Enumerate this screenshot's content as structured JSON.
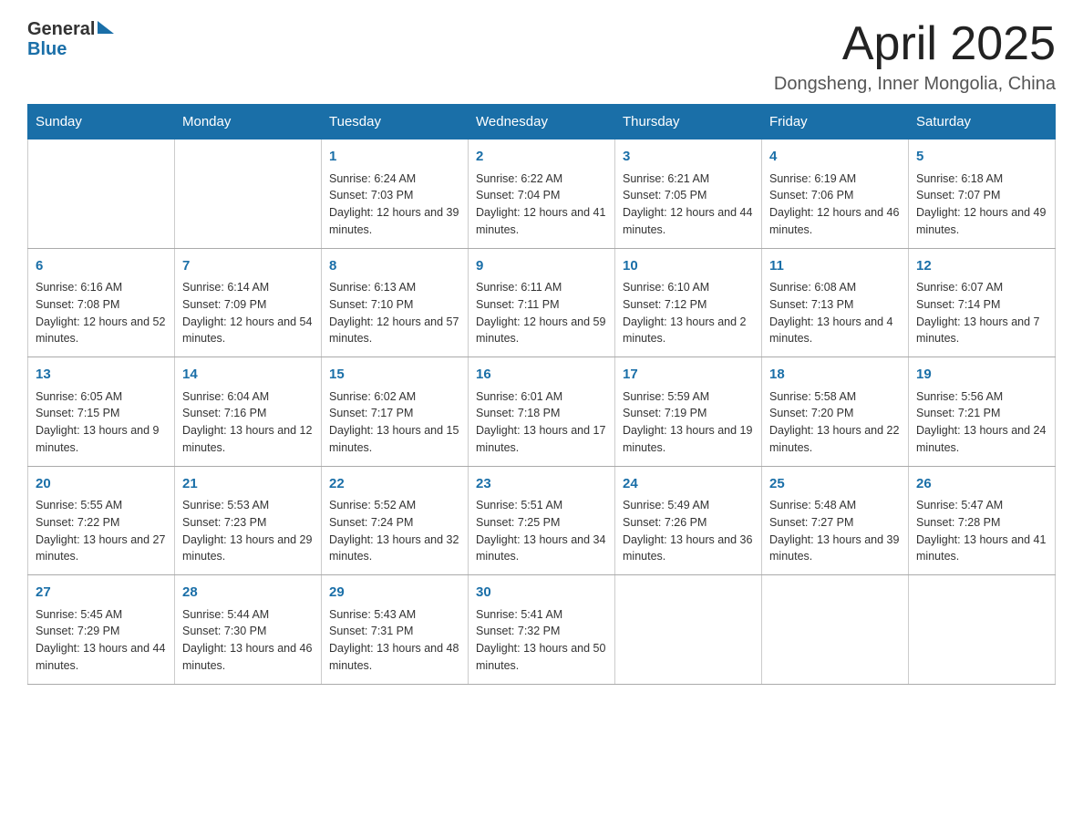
{
  "header": {
    "logo_general": "General",
    "logo_blue": "Blue",
    "month_year": "April 2025",
    "location": "Dongsheng, Inner Mongolia, China"
  },
  "weekdays": [
    "Sunday",
    "Monday",
    "Tuesday",
    "Wednesday",
    "Thursday",
    "Friday",
    "Saturday"
  ],
  "weeks": [
    [
      {
        "day": "",
        "sunrise": "",
        "sunset": "",
        "daylight": ""
      },
      {
        "day": "",
        "sunrise": "",
        "sunset": "",
        "daylight": ""
      },
      {
        "day": "1",
        "sunrise": "Sunrise: 6:24 AM",
        "sunset": "Sunset: 7:03 PM",
        "daylight": "Daylight: 12 hours and 39 minutes."
      },
      {
        "day": "2",
        "sunrise": "Sunrise: 6:22 AM",
        "sunset": "Sunset: 7:04 PM",
        "daylight": "Daylight: 12 hours and 41 minutes."
      },
      {
        "day": "3",
        "sunrise": "Sunrise: 6:21 AM",
        "sunset": "Sunset: 7:05 PM",
        "daylight": "Daylight: 12 hours and 44 minutes."
      },
      {
        "day": "4",
        "sunrise": "Sunrise: 6:19 AM",
        "sunset": "Sunset: 7:06 PM",
        "daylight": "Daylight: 12 hours and 46 minutes."
      },
      {
        "day": "5",
        "sunrise": "Sunrise: 6:18 AM",
        "sunset": "Sunset: 7:07 PM",
        "daylight": "Daylight: 12 hours and 49 minutes."
      }
    ],
    [
      {
        "day": "6",
        "sunrise": "Sunrise: 6:16 AM",
        "sunset": "Sunset: 7:08 PM",
        "daylight": "Daylight: 12 hours and 52 minutes."
      },
      {
        "day": "7",
        "sunrise": "Sunrise: 6:14 AM",
        "sunset": "Sunset: 7:09 PM",
        "daylight": "Daylight: 12 hours and 54 minutes."
      },
      {
        "day": "8",
        "sunrise": "Sunrise: 6:13 AM",
        "sunset": "Sunset: 7:10 PM",
        "daylight": "Daylight: 12 hours and 57 minutes."
      },
      {
        "day": "9",
        "sunrise": "Sunrise: 6:11 AM",
        "sunset": "Sunset: 7:11 PM",
        "daylight": "Daylight: 12 hours and 59 minutes."
      },
      {
        "day": "10",
        "sunrise": "Sunrise: 6:10 AM",
        "sunset": "Sunset: 7:12 PM",
        "daylight": "Daylight: 13 hours and 2 minutes."
      },
      {
        "day": "11",
        "sunrise": "Sunrise: 6:08 AM",
        "sunset": "Sunset: 7:13 PM",
        "daylight": "Daylight: 13 hours and 4 minutes."
      },
      {
        "day": "12",
        "sunrise": "Sunrise: 6:07 AM",
        "sunset": "Sunset: 7:14 PM",
        "daylight": "Daylight: 13 hours and 7 minutes."
      }
    ],
    [
      {
        "day": "13",
        "sunrise": "Sunrise: 6:05 AM",
        "sunset": "Sunset: 7:15 PM",
        "daylight": "Daylight: 13 hours and 9 minutes."
      },
      {
        "day": "14",
        "sunrise": "Sunrise: 6:04 AM",
        "sunset": "Sunset: 7:16 PM",
        "daylight": "Daylight: 13 hours and 12 minutes."
      },
      {
        "day": "15",
        "sunrise": "Sunrise: 6:02 AM",
        "sunset": "Sunset: 7:17 PM",
        "daylight": "Daylight: 13 hours and 15 minutes."
      },
      {
        "day": "16",
        "sunrise": "Sunrise: 6:01 AM",
        "sunset": "Sunset: 7:18 PM",
        "daylight": "Daylight: 13 hours and 17 minutes."
      },
      {
        "day": "17",
        "sunrise": "Sunrise: 5:59 AM",
        "sunset": "Sunset: 7:19 PM",
        "daylight": "Daylight: 13 hours and 19 minutes."
      },
      {
        "day": "18",
        "sunrise": "Sunrise: 5:58 AM",
        "sunset": "Sunset: 7:20 PM",
        "daylight": "Daylight: 13 hours and 22 minutes."
      },
      {
        "day": "19",
        "sunrise": "Sunrise: 5:56 AM",
        "sunset": "Sunset: 7:21 PM",
        "daylight": "Daylight: 13 hours and 24 minutes."
      }
    ],
    [
      {
        "day": "20",
        "sunrise": "Sunrise: 5:55 AM",
        "sunset": "Sunset: 7:22 PM",
        "daylight": "Daylight: 13 hours and 27 minutes."
      },
      {
        "day": "21",
        "sunrise": "Sunrise: 5:53 AM",
        "sunset": "Sunset: 7:23 PM",
        "daylight": "Daylight: 13 hours and 29 minutes."
      },
      {
        "day": "22",
        "sunrise": "Sunrise: 5:52 AM",
        "sunset": "Sunset: 7:24 PM",
        "daylight": "Daylight: 13 hours and 32 minutes."
      },
      {
        "day": "23",
        "sunrise": "Sunrise: 5:51 AM",
        "sunset": "Sunset: 7:25 PM",
        "daylight": "Daylight: 13 hours and 34 minutes."
      },
      {
        "day": "24",
        "sunrise": "Sunrise: 5:49 AM",
        "sunset": "Sunset: 7:26 PM",
        "daylight": "Daylight: 13 hours and 36 minutes."
      },
      {
        "day": "25",
        "sunrise": "Sunrise: 5:48 AM",
        "sunset": "Sunset: 7:27 PM",
        "daylight": "Daylight: 13 hours and 39 minutes."
      },
      {
        "day": "26",
        "sunrise": "Sunrise: 5:47 AM",
        "sunset": "Sunset: 7:28 PM",
        "daylight": "Daylight: 13 hours and 41 minutes."
      }
    ],
    [
      {
        "day": "27",
        "sunrise": "Sunrise: 5:45 AM",
        "sunset": "Sunset: 7:29 PM",
        "daylight": "Daylight: 13 hours and 44 minutes."
      },
      {
        "day": "28",
        "sunrise": "Sunrise: 5:44 AM",
        "sunset": "Sunset: 7:30 PM",
        "daylight": "Daylight: 13 hours and 46 minutes."
      },
      {
        "day": "29",
        "sunrise": "Sunrise: 5:43 AM",
        "sunset": "Sunset: 7:31 PM",
        "daylight": "Daylight: 13 hours and 48 minutes."
      },
      {
        "day": "30",
        "sunrise": "Sunrise: 5:41 AM",
        "sunset": "Sunset: 7:32 PM",
        "daylight": "Daylight: 13 hours and 50 minutes."
      },
      {
        "day": "",
        "sunrise": "",
        "sunset": "",
        "daylight": ""
      },
      {
        "day": "",
        "sunrise": "",
        "sunset": "",
        "daylight": ""
      },
      {
        "day": "",
        "sunrise": "",
        "sunset": "",
        "daylight": ""
      }
    ]
  ]
}
